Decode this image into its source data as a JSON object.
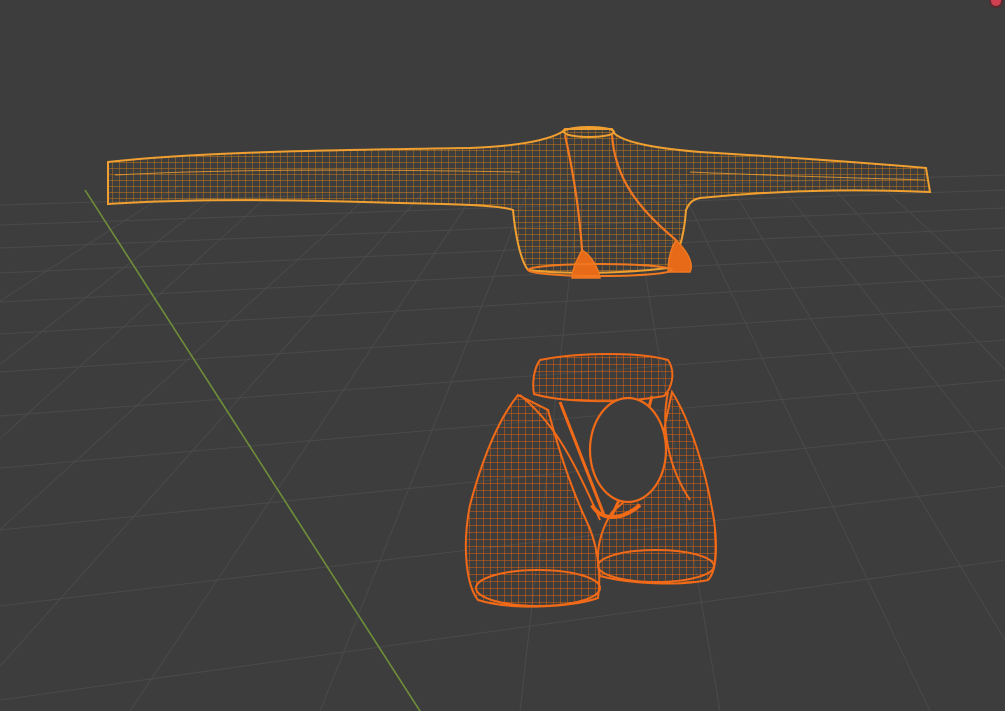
{
  "viewport": {
    "mode": "wireframe",
    "background_color": "#3d3d3d",
    "grid_color": "#4a4a4a",
    "y_axis_color": "#6e8f3a"
  },
  "objects": [
    {
      "name": "upper-garment",
      "color": "#f0a030",
      "selected": true
    },
    {
      "name": "chest-strap",
      "color": "#f07820",
      "selected": true
    },
    {
      "name": "lower-garment",
      "color": "#f06a18",
      "selected": true
    }
  ],
  "icons": {
    "corner": "record-dot-icon"
  }
}
